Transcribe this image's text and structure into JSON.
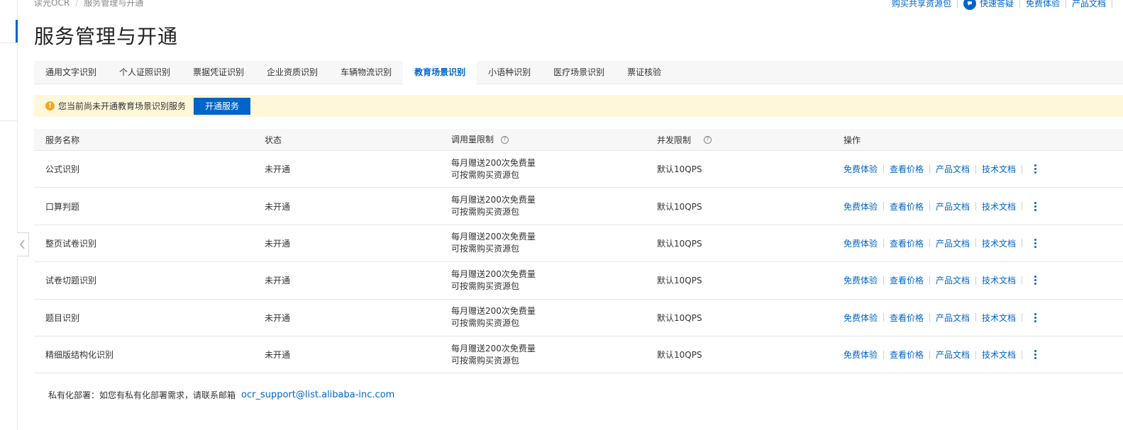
{
  "breadcrumb": {
    "items": [
      "读光OCR",
      "服务管理与开通"
    ]
  },
  "top_links": {
    "buy_pack": "购买共享资源包",
    "quick_qa": "快速答疑",
    "free_trial": "免费体验",
    "product_docs": "产品文档"
  },
  "page_title": "服务管理与开通",
  "tabs": [
    {
      "label": "通用文字识别",
      "active": false
    },
    {
      "label": "个人证照识别",
      "active": false
    },
    {
      "label": "票据凭证识别",
      "active": false
    },
    {
      "label": "企业资质识别",
      "active": false
    },
    {
      "label": "车辆物流识别",
      "active": false
    },
    {
      "label": "教育场景识别",
      "active": true
    },
    {
      "label": "小语种识别",
      "active": false
    },
    {
      "label": "医疗场景识别",
      "active": false
    },
    {
      "label": "票证核验",
      "active": false
    }
  ],
  "notice": {
    "text": "您当前尚未开通教育场景识别服务",
    "button": "开通服务"
  },
  "table": {
    "headers": {
      "name": "服务名称",
      "status": "状态",
      "quota": "调用量限制",
      "concurrency": "并发限制",
      "ops": "操作"
    },
    "op_labels": [
      "免费体验",
      "查看价格",
      "产品文档",
      "技术文档"
    ],
    "rows": [
      {
        "name": "公式识别",
        "status": "未开通",
        "quota_line1": "每月赠送200次免费量",
        "quota_line2": "可按需购买资源包",
        "concurrency": "默认10QPS"
      },
      {
        "name": "口算判题",
        "status": "未开通",
        "quota_line1": "每月赠送200次免费量",
        "quota_line2": "可按需购买资源包",
        "concurrency": "默认10QPS"
      },
      {
        "name": "整页试卷识别",
        "status": "未开通",
        "quota_line1": "每月赠送200次免费量",
        "quota_line2": "可按需购买资源包",
        "concurrency": "默认10QPS"
      },
      {
        "name": "试卷切题识别",
        "status": "未开通",
        "quota_line1": "每月赠送200次免费量",
        "quota_line2": "可按需购买资源包",
        "concurrency": "默认10QPS"
      },
      {
        "name": "题目识别",
        "status": "未开通",
        "quota_line1": "每月赠送200次免费量",
        "quota_line2": "可按需购买资源包",
        "concurrency": "默认10QPS"
      },
      {
        "name": "精细版结构化识别",
        "status": "未开通",
        "quota_line1": "每月赠送200次免费量",
        "quota_line2": "可按需购买资源包",
        "concurrency": "默认10QPS"
      }
    ]
  },
  "footer": {
    "text": "私有化部署：如您有私有化部署需求，请联系邮箱",
    "email": "ocr_support@list.alibaba-inc.com"
  },
  "colors": {
    "accent": "#0064c8",
    "notice_bg": "#fff7d9",
    "warning": "#f5a623"
  }
}
